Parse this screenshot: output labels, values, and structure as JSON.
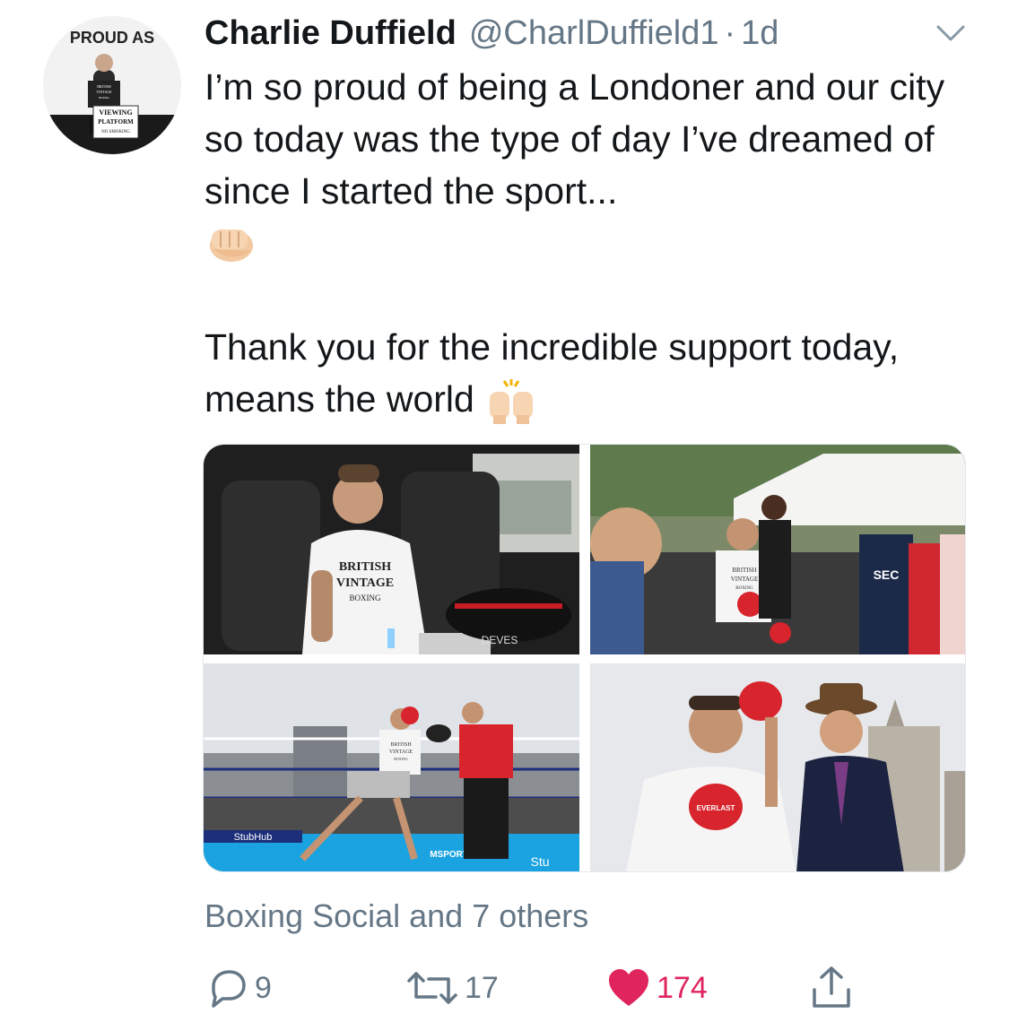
{
  "tweet": {
    "author_name": "Charlie Duffield",
    "author_handle": "@CharlDuffield1",
    "separator": "·",
    "timestamp": "1d",
    "text_para1": "I’m so proud of being a Londoner and our city so today was the type of day I’ve dreamed of since I started the sport...",
    "text_para2": "Thank you for the incredible support today, means the world",
    "avatar_text": {
      "top": "PROUD AS",
      "sign_line1": "VIEWING",
      "sign_line2": "PLATFORM",
      "sign_line3": "NO SMOKING",
      "shirt_line1": "BRITISH",
      "shirt_line2": "VINTAGE",
      "shirt_line3": "BOXING"
    },
    "emoji": {
      "fist": "fist-icon",
      "raised_hands": "raised-hands-icon"
    }
  },
  "media": {
    "photos": [
      {
        "name": "photo-car",
        "shirt_line1": "BRITISH",
        "shirt_line2": "VINTAGE",
        "shirt_line3": "BOXING",
        "bag_text": "DEVES"
      },
      {
        "name": "photo-crowd",
        "shirt_line1": "BRITISH",
        "shirt_line2": "VINTAGE",
        "shirt_line3": "BOXING",
        "vest_text": "SEC"
      },
      {
        "name": "photo-ring",
        "shirt_line1": "BRITISH",
        "shirt_line2": "VINTAGE",
        "shirt_line3": "BOXING",
        "banner1": "StubHub",
        "banner2": "MSPORTS.COM",
        "banner3": "Stu"
      },
      {
        "name": "photo-portrait",
        "glove_text": "EVERLAST"
      }
    ]
  },
  "social_context": "Boxing Social and 7 others",
  "actions": {
    "reply_count": "9",
    "retweet_count": "17",
    "like_count": "174"
  },
  "colors": {
    "primary_text": "#14171a",
    "secondary_text": "#657786",
    "like_red": "#e0245e",
    "border": "#e1e8ed"
  }
}
